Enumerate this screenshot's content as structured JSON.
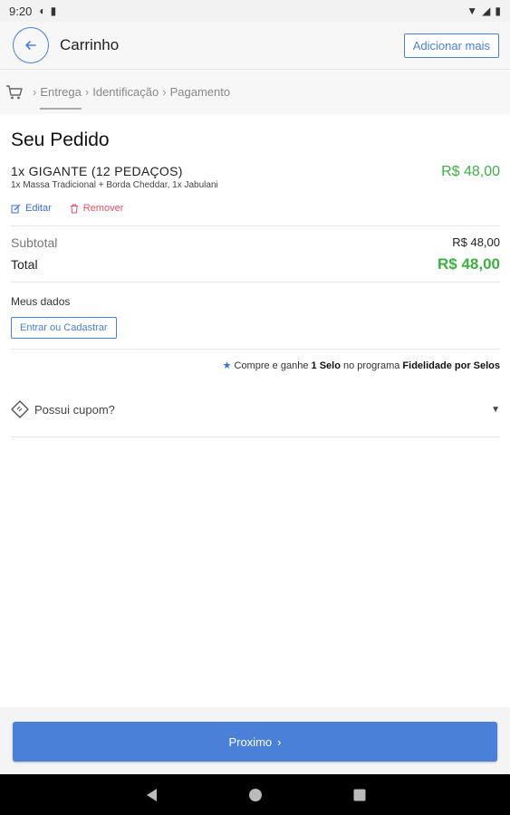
{
  "status_bar": {
    "time": "9:20"
  },
  "header": {
    "title": "Carrinho",
    "add_more_label": "Adicionar mais"
  },
  "steps": [
    {
      "label": "Entrega",
      "active": true
    },
    {
      "label": "Identificação",
      "active": false
    },
    {
      "label": "Pagamento",
      "active": false
    }
  ],
  "order": {
    "title": "Seu Pedido",
    "item": {
      "name": "1x GIGANTE (12 PEDAÇOS)",
      "description": "1x Massa Tradicional + Borda Cheddar, 1x Jabulani",
      "price": "R$ 48,00",
      "edit_label": "Editar",
      "remove_label": "Remover"
    },
    "subtotal_label": "Subtotal",
    "subtotal_value": "R$ 48,00",
    "total_label": "Total",
    "total_value": "R$ 48,00"
  },
  "my_data": {
    "label": "Meus dados",
    "login_button": "Entrar ou Cadastrar"
  },
  "loyalty": {
    "prefix": "Compre e ganhe",
    "reward": "1 Selo",
    "middle": "no programa",
    "program": "Fidelidade por Selos"
  },
  "coupon": {
    "label": "Possui cupom?"
  },
  "footer": {
    "next_label": "Proximo"
  },
  "colors": {
    "accent": "#4a80d8",
    "price_green": "#3cb043",
    "remove_red": "#e8506a"
  }
}
